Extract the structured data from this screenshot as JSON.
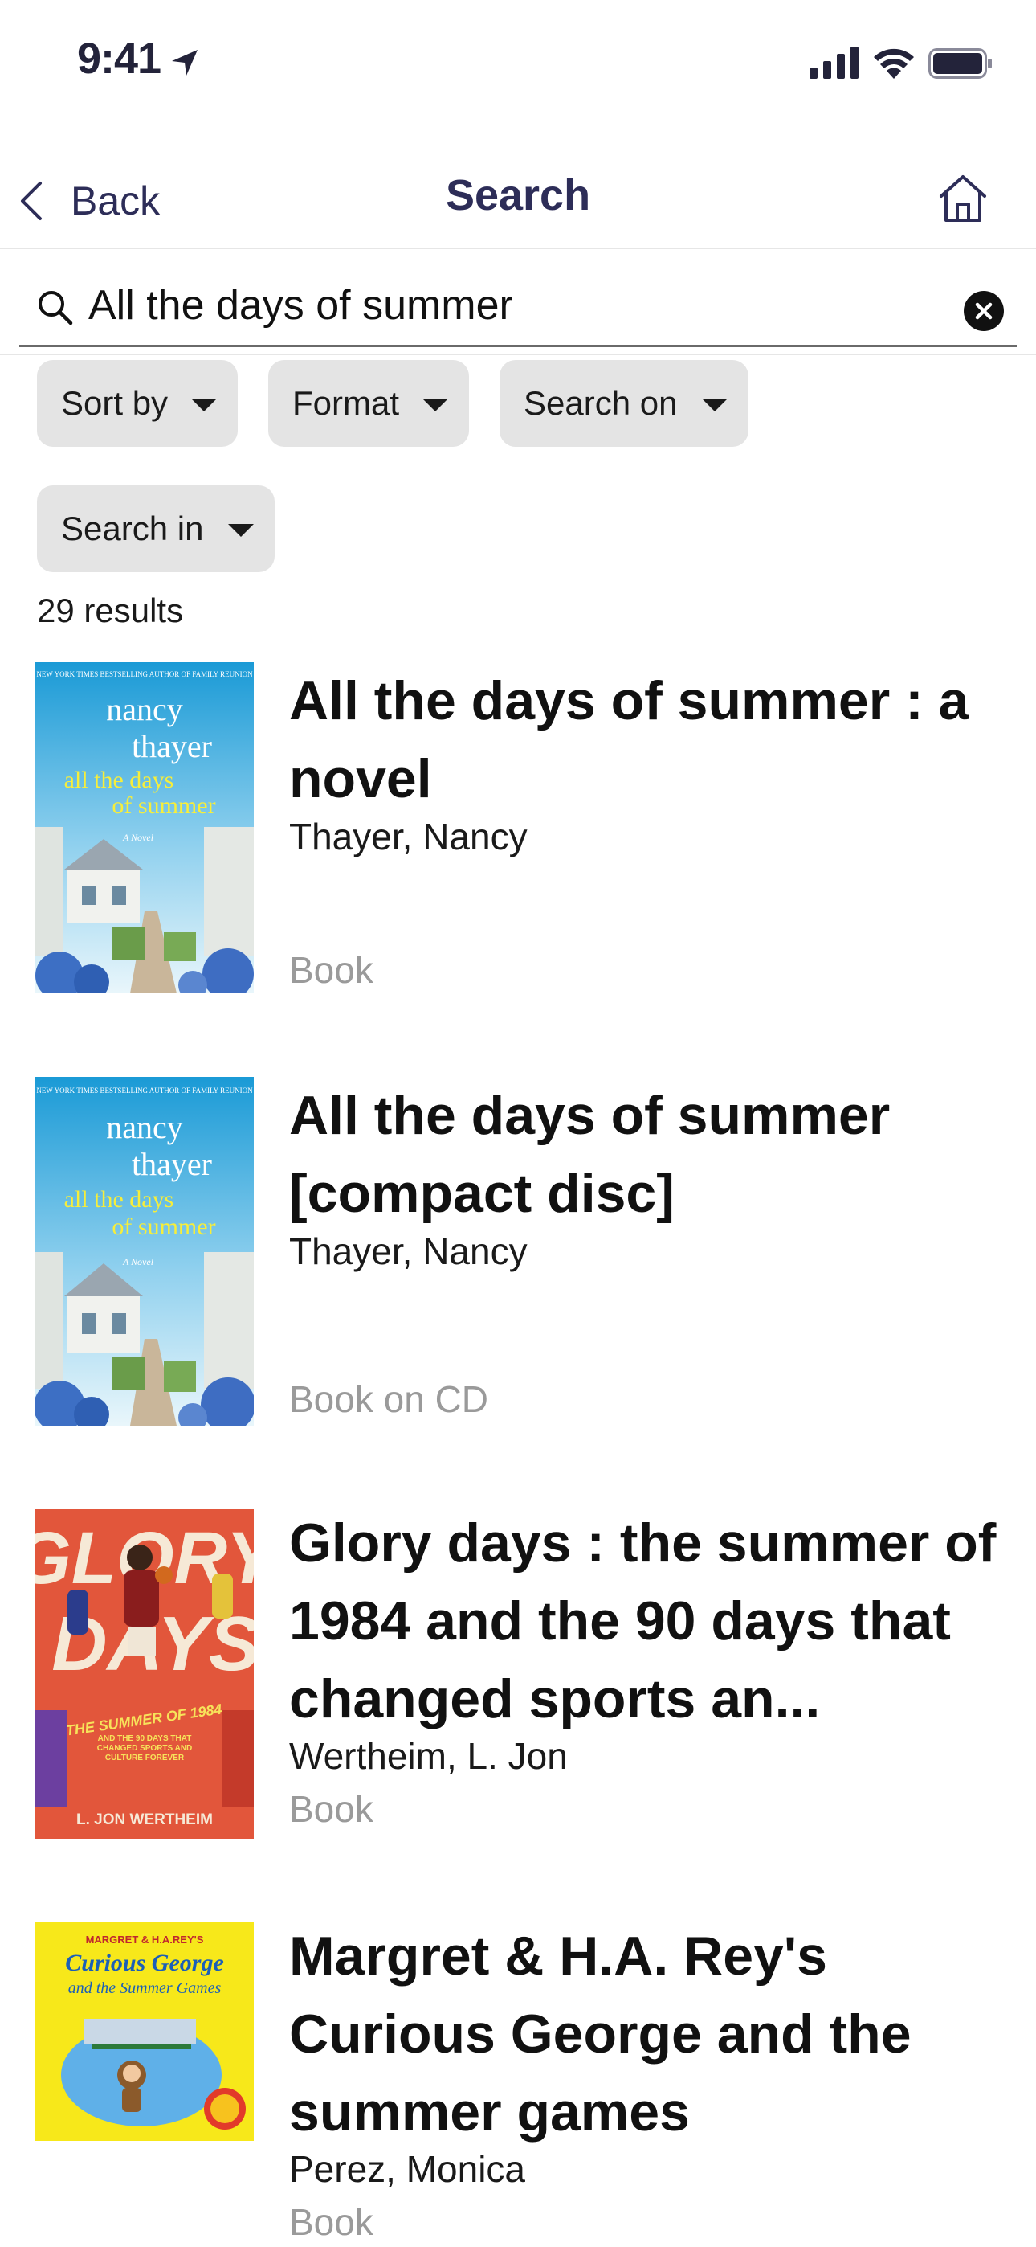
{
  "status_bar": {
    "time": "9:41"
  },
  "nav": {
    "back_label": "Back",
    "title": "Search"
  },
  "search": {
    "value": "All the days of summer",
    "placeholder": ""
  },
  "filters": [
    {
      "label": "Sort by"
    },
    {
      "label": "Format"
    },
    {
      "label": "Search on"
    },
    {
      "label": "Search in"
    }
  ],
  "results_count": "29 results",
  "results": [
    {
      "title": "All the days of summer : a novel",
      "author": "Thayer, Nancy",
      "format": "Book",
      "cover": {
        "tagline": "NEW YORK TIMES BESTSELLING AUTHOR OF FAMILY REUNION",
        "author_first": "nancy",
        "author_last": "thayer",
        "title_line1": "all the days",
        "title_line2": "of summer",
        "subtitle": "A Novel"
      }
    },
    {
      "title": "All the days of summer [compact disc]",
      "author": "Thayer, Nancy",
      "format": "Book on CD",
      "cover": {
        "tagline": "NEW YORK TIMES BESTSELLING AUTHOR OF FAMILY REUNION",
        "author_first": "nancy",
        "author_last": "thayer",
        "title_line1": "all the days",
        "title_line2": "of summer",
        "subtitle": "A Novel"
      }
    },
    {
      "title": "Glory days : the summer of 1984 and the 90 days that changed sports an...",
      "author": "Wertheim, L. Jon",
      "format": "Book",
      "cover": {
        "title_line1": "GLORY",
        "title_line2": "DAYS",
        "subtitle": "THE SUMMER OF 1984",
        "blurb": "AND THE 90 DAYS THAT CHANGED SPORTS AND CULTURE FOREVER",
        "author": "L. JON WERTHEIM"
      }
    },
    {
      "title": "Margret & H.A. Rey's Curious George and the summer games",
      "author": "Perez, Monica",
      "format": "Book",
      "cover": {
        "tagline": "MARGRET & H.A.REY'S",
        "title_line1": "Curious George",
        "title_line2": "and the Summer Games"
      }
    }
  ]
}
